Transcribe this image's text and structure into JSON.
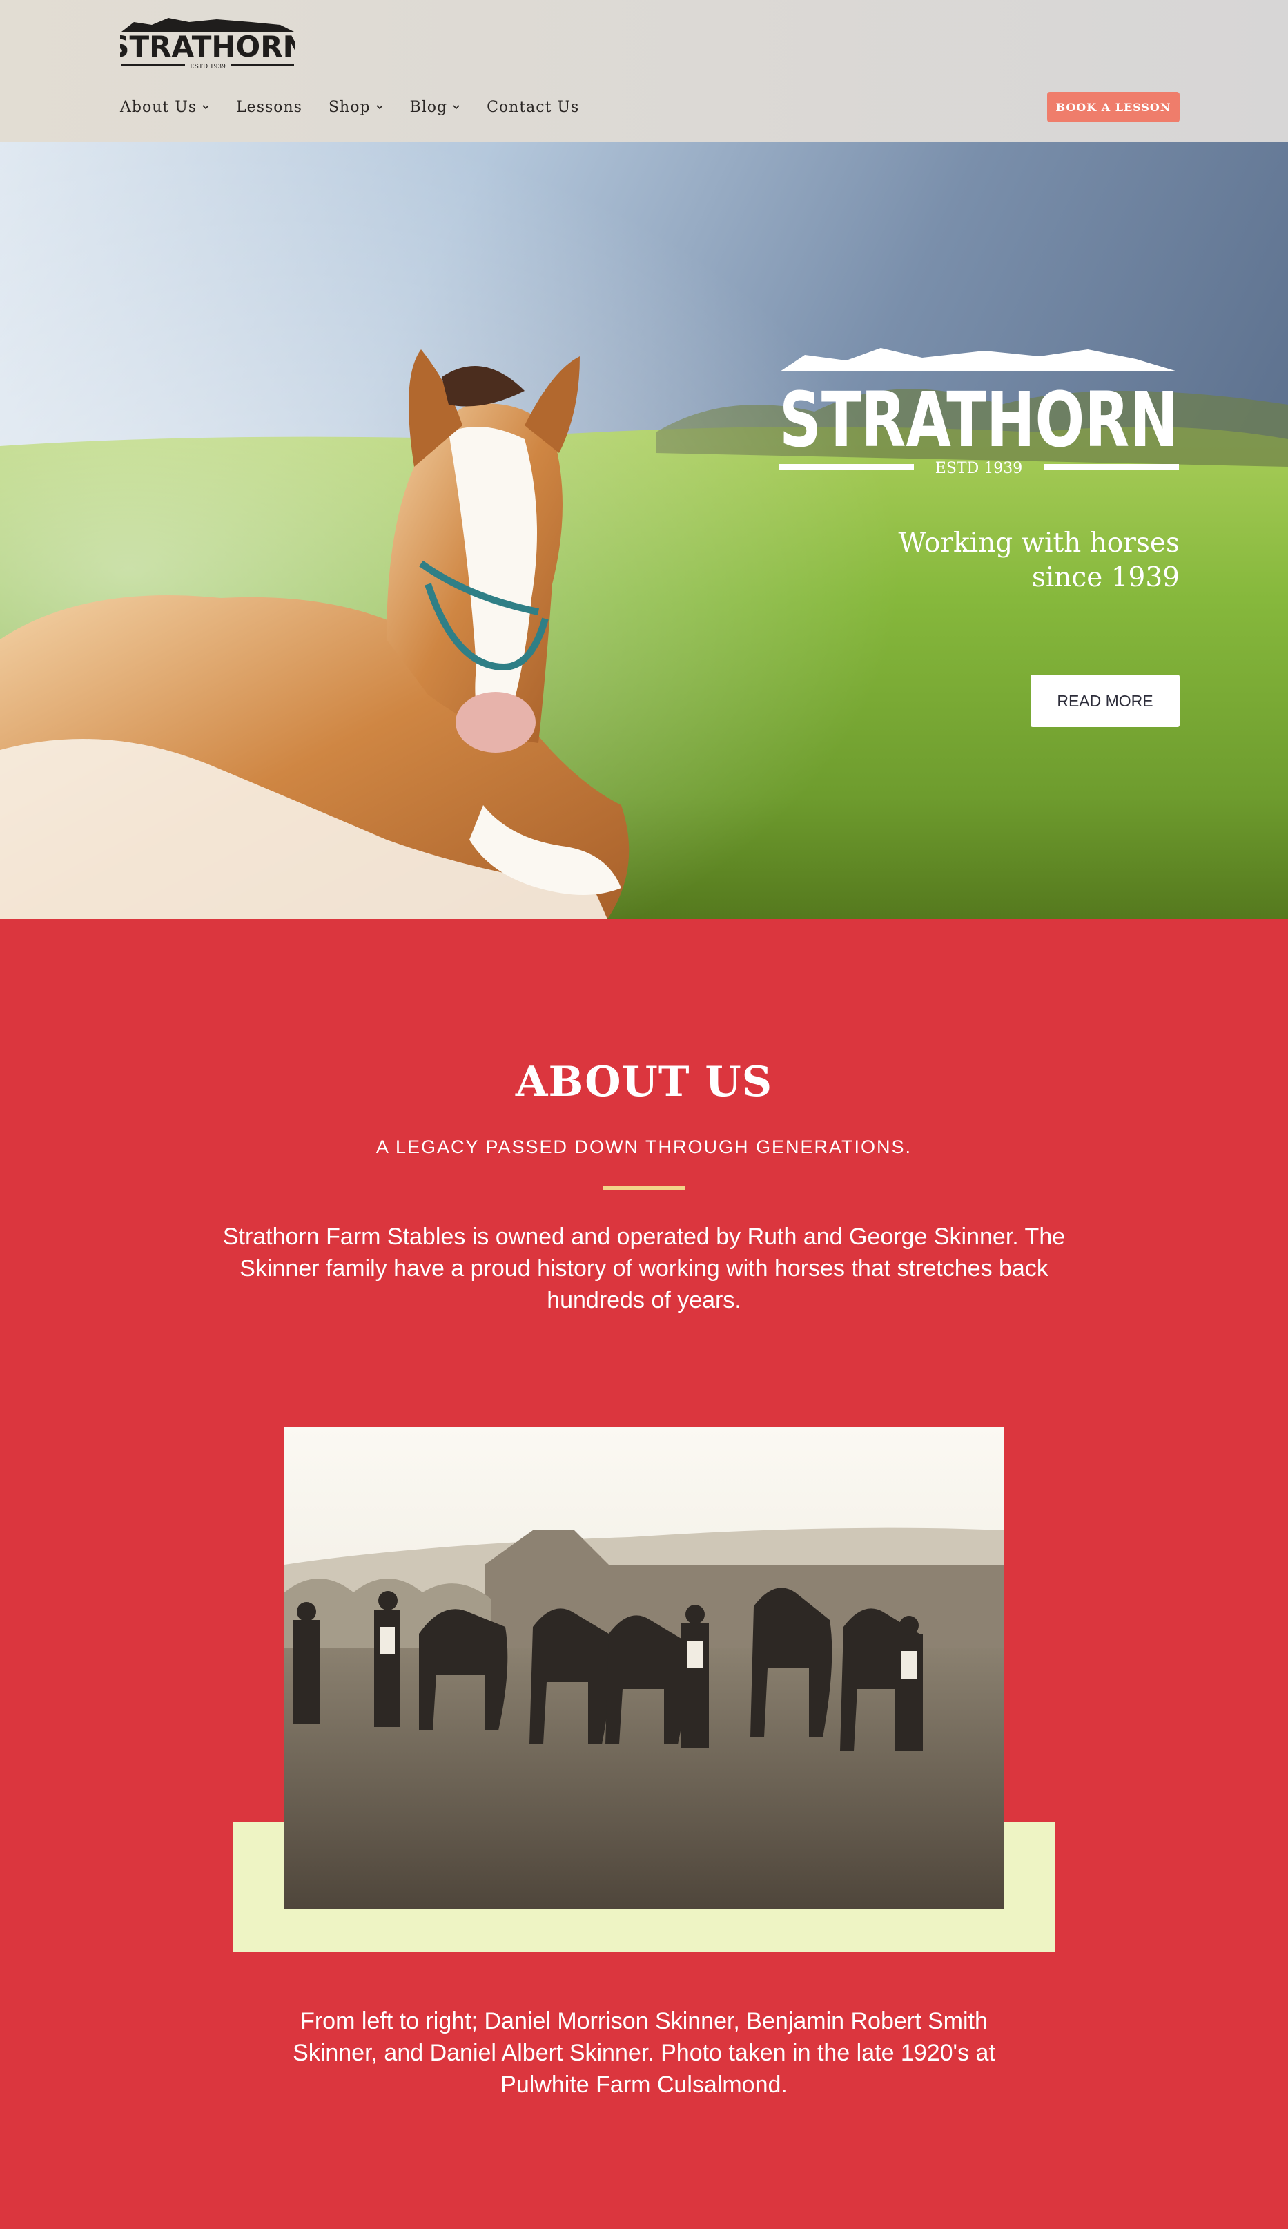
{
  "header": {
    "logo_text": "STRATHORN",
    "logo_sub": "ESTD 1939",
    "nav": [
      {
        "label": "About Us",
        "icon": "chevron-down-icon"
      },
      {
        "label": "Lessons"
      },
      {
        "label": "Shop",
        "icon": "chevron-down-icon"
      },
      {
        "label": "Blog",
        "icon": "chevron-down-icon"
      },
      {
        "label": "Contact Us"
      }
    ],
    "cta_label": "BOOK A LESSON"
  },
  "hero": {
    "logo_text": "STRATHORN",
    "logo_sub": "ESTD 1939",
    "tagline_line1": "Working with horses",
    "tagline_line2": "since 1939",
    "button_label": "READ MORE"
  },
  "about": {
    "title": "ABOUT US",
    "subtitle": "A LEGACY PASSED DOWN THROUGH GENERATIONS.",
    "body": "Strathorn Farm Stables is owned and operated by Ruth and George Skinner. The Skinner family have a proud history of working with horses that stretches back hundreds of years.",
    "caption": "From left to right; Daniel Morrison Skinner, Benjamin Robert Smith Skinner, and Daniel Albert Skinner. Photo taken in the late 1920's at Pulwhite Farm Culsalmond."
  },
  "colors": {
    "accent": "#db363e",
    "cta": "#ef7d6b",
    "rule": "#f2d38a",
    "frame": "#eef4c4"
  }
}
